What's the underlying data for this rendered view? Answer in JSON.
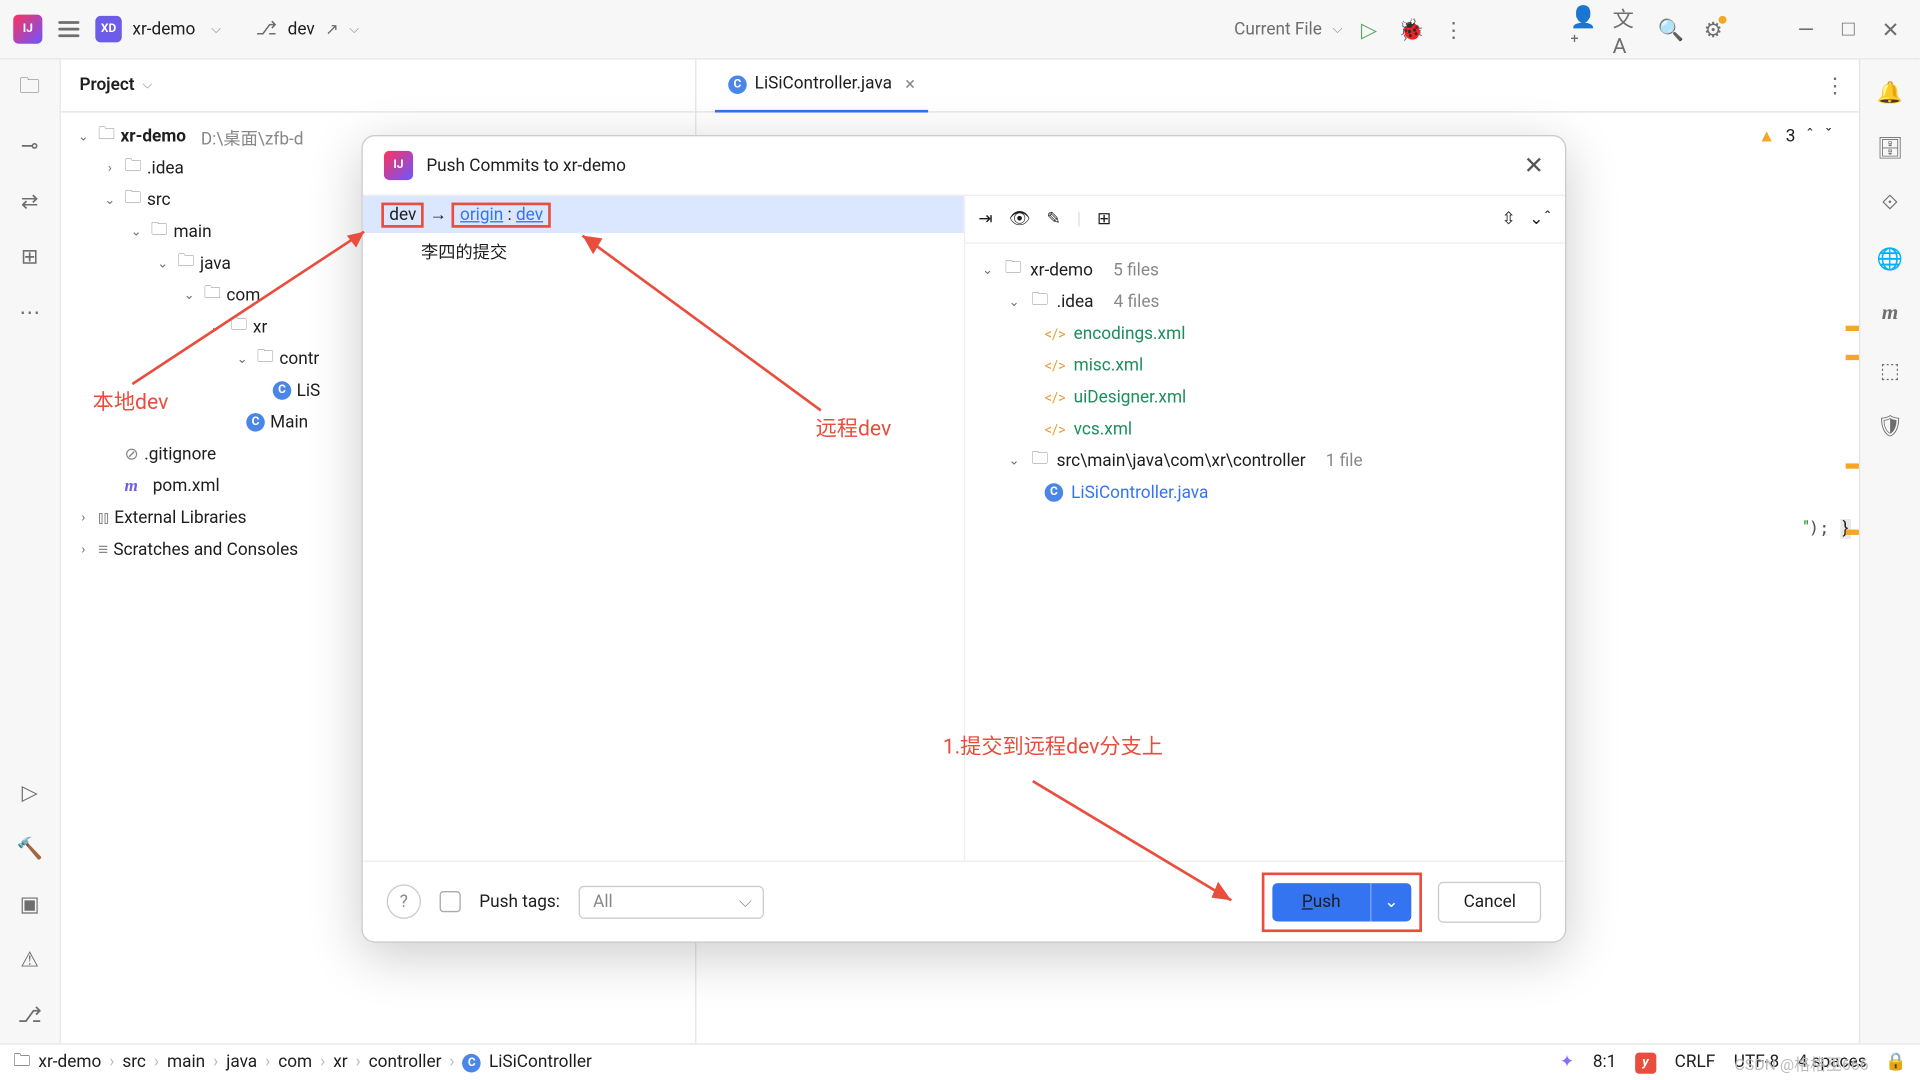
{
  "topbar": {
    "project": "xr-demo",
    "branch": "dev",
    "run_config": "Current File"
  },
  "project_panel": {
    "title": "Project",
    "root": "xr-demo",
    "root_path": "D:\\桌面\\zfb-d",
    "nodes": {
      "idea": ".idea",
      "src": "src",
      "main": "main",
      "java": "java",
      "com": "com",
      "xr": "xr",
      "contr": "contr",
      "lisi": "LiS",
      "mainj": "Main",
      "gitignore": ".gitignore",
      "pom": "pom.xml",
      "ext": "External Libraries",
      "scratch": "Scratches and Consoles"
    }
  },
  "tab": {
    "name": "LiSiController.java"
  },
  "warnings": {
    "count": "3"
  },
  "dialog": {
    "title": "Push Commits to xr-demo",
    "local_branch": "dev",
    "remote": "origin",
    "remote_branch": "dev",
    "commit": "李四的提交",
    "files": {
      "root": "xr-demo",
      "root_count": "5 files",
      "idea": ".idea",
      "idea_count": "4 files",
      "f1": "encodings.xml",
      "f2": "misc.xml",
      "f3": "uiDesigner.xml",
      "f4": "vcs.xml",
      "ctrl_path": "src\\main\\java\\com\\xr\\controller",
      "ctrl_count": "1 file",
      "ctrl_file": "LiSiController.java"
    },
    "push_tags_label": "Push tags:",
    "tags_sel": "All",
    "push": "Push",
    "cancel": "Cancel"
  },
  "anno": {
    "local": "本地dev",
    "remote": "远程dev",
    "step": "1.提交到远程dev分支上"
  },
  "breadcrumb": [
    "xr-demo",
    "src",
    "main",
    "java",
    "com",
    "xr",
    "controller",
    "LiSiController"
  ],
  "status": {
    "pos": "8:1",
    "crlf": "CRLF",
    "enc": "UTF-8",
    "indent": "4 spaces"
  },
  "watermark": "CSDN @格格巫666"
}
